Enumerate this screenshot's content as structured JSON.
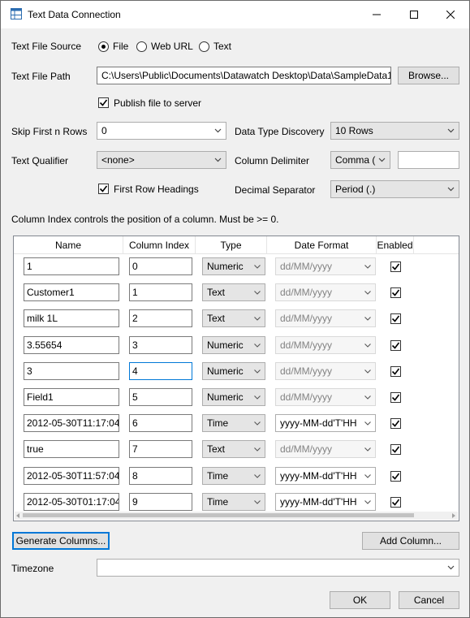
{
  "window": {
    "title": "Text Data Connection",
    "icon": "app-grid-icon",
    "controls": [
      "minimize-icon",
      "maximize-icon",
      "close-icon"
    ]
  },
  "source": {
    "label": "Text File Source",
    "options": [
      "File",
      "Web URL",
      "Text"
    ],
    "selected": "File"
  },
  "path": {
    "label": "Text File Path",
    "value": "C:\\Users\\Public\\Documents\\Datawatch Desktop\\Data\\SampleData1",
    "browse_label": "Browse..."
  },
  "publish": {
    "label": "Publish file to server",
    "checked": true
  },
  "skip": {
    "label": "Skip First n Rows",
    "value": "0"
  },
  "discovery": {
    "label": "Data Type Discovery",
    "value": "10 Rows"
  },
  "qualifier": {
    "label": "Text Qualifier",
    "value": "<none>"
  },
  "delimiter": {
    "label": "Column Delimiter",
    "value": "Comma (",
    "custom": ""
  },
  "first_row": {
    "label": "First Row Headings",
    "checked": true
  },
  "decimal": {
    "label": "Decimal Separator",
    "value": "Period (.)"
  },
  "hint": "Column Index controls the position of a column. Must be >= 0.",
  "columns_table": {
    "headers": [
      "Name",
      "Column Index",
      "Type",
      "Date Format",
      "Enabled"
    ],
    "rows": [
      {
        "name": "1",
        "index": "0",
        "type": "Numeric",
        "date": "dd/MM/yyyy",
        "date_enabled": false,
        "enabled": true
      },
      {
        "name": "Customer1",
        "index": "1",
        "type": "Text",
        "date": "dd/MM/yyyy",
        "date_enabled": false,
        "enabled": true
      },
      {
        "name": "milk 1L",
        "index": "2",
        "type": "Text",
        "date": "dd/MM/yyyy",
        "date_enabled": false,
        "enabled": true
      },
      {
        "name": "3.55654",
        "index": "3",
        "type": "Numeric",
        "date": "dd/MM/yyyy",
        "date_enabled": false,
        "enabled": true
      },
      {
        "name": "3",
        "index": "4",
        "type": "Numeric",
        "date": "dd/MM/yyyy",
        "date_enabled": false,
        "enabled": true
      },
      {
        "name": "Field1",
        "index": "5",
        "type": "Numeric",
        "date": "dd/MM/yyyy",
        "date_enabled": false,
        "enabled": true
      },
      {
        "name": "2012-05-30T11:17:04",
        "index": "6",
        "type": "Time",
        "date": "yyyy-MM-dd'T'HH",
        "date_enabled": true,
        "enabled": true
      },
      {
        "name": "true",
        "index": "7",
        "type": "Text",
        "date": "dd/MM/yyyy",
        "date_enabled": false,
        "enabled": true
      },
      {
        "name": "2012-05-30T11:57:04",
        "index": "8",
        "type": "Time",
        "date": "yyyy-MM-dd'T'HH",
        "date_enabled": true,
        "enabled": true
      },
      {
        "name": "2012-05-30T01:17:04",
        "index": "9",
        "type": "Time",
        "date": "yyyy-MM-dd'T'HH",
        "date_enabled": true,
        "enabled": true
      }
    ]
  },
  "buttons": {
    "generate": "Generate Columns...",
    "add_column": "Add Column...",
    "ok": "OK",
    "cancel": "Cancel"
  },
  "timezone": {
    "label": "Timezone",
    "value": ""
  }
}
